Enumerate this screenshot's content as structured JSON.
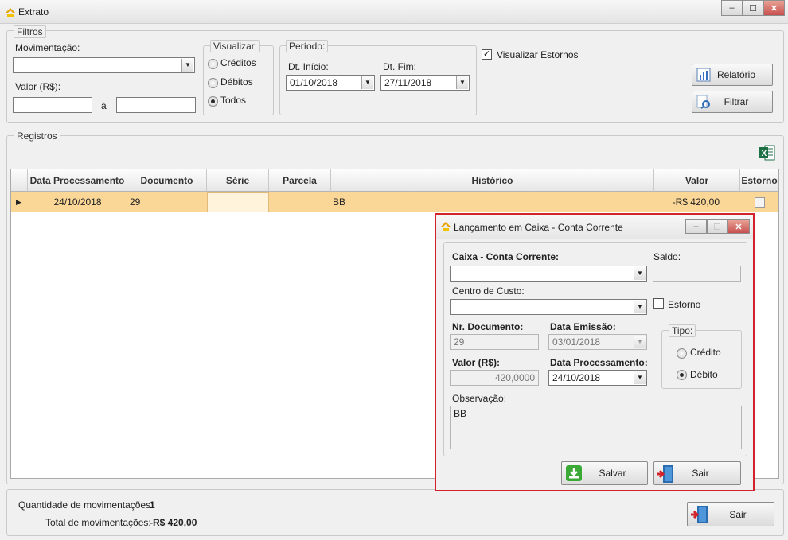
{
  "window": {
    "title": "Extrato",
    "min": "–",
    "max": "☐",
    "close": "✕"
  },
  "filtros": {
    "legend": "Filtros",
    "movimentacao_label": "Movimentação:",
    "movimentacao_value": "",
    "valor_label": "Valor (R$):",
    "valor_de": "",
    "valor_sep": "à",
    "valor_ate": "",
    "visualizar": {
      "legend": "Visualizar:",
      "options": [
        "Créditos",
        "Débitos",
        "Todos"
      ],
      "selected": "Todos"
    },
    "periodo": {
      "legend": "Período:",
      "inicio_label": "Dt. Início:",
      "inicio_value": "01/10/2018",
      "fim_label": "Dt. Fim:",
      "fim_value": "27/11/2018"
    },
    "estornos_label": "Visualizar Estornos",
    "estornos_checked": true,
    "relatorio_label": "Relatório",
    "filtrar_label": "Filtrar"
  },
  "registros": {
    "legend": "Registros",
    "columns": [
      "Data Processamento",
      "Documento",
      "Série",
      "Parcela",
      "Histórico",
      "Valor",
      "Estorno"
    ],
    "rows": [
      {
        "data": "24/10/2018",
        "documento": "29",
        "serie": "",
        "parcela": "",
        "historico": "BB",
        "valor": "-R$ 420,00",
        "estorno": false
      }
    ]
  },
  "footer": {
    "qtd_label": "Quantidade de movimentações:",
    "qtd_value": "1",
    "total_label": "Total de movimentações:",
    "total_value": "-R$ 420,00",
    "sair_label": "Sair"
  },
  "dialog": {
    "title": "Lançamento em Caixa - Conta Corrente",
    "caixa_label": "Caixa - Conta Corrente:",
    "caixa_value": "",
    "saldo_label": "Saldo:",
    "saldo_value": "",
    "centro_label": "Centro de Custo:",
    "centro_value": "",
    "estorno_label": "Estorno",
    "estorno_checked": false,
    "nr_doc_label": "Nr. Documento:",
    "nr_doc_value": "29",
    "data_emissao_label": "Data Emissão:",
    "data_emissao_value": "03/01/2018",
    "tipo_legend": "Tipo:",
    "tipo_options": [
      "Crédito",
      "Débito"
    ],
    "tipo_selected": "Débito",
    "valor_label": "Valor (R$):",
    "valor_value": "420,0000",
    "data_proc_label": "Data Processamento:",
    "data_proc_value": "24/10/2018",
    "obs_label": "Observação:",
    "obs_value": "BB",
    "salvar_label": "Salvar",
    "sair_label": "Sair"
  },
  "colors": {
    "selected_row": "#fbd797",
    "dialog_border": "#d2232a",
    "excel_green": "#1d7044"
  }
}
